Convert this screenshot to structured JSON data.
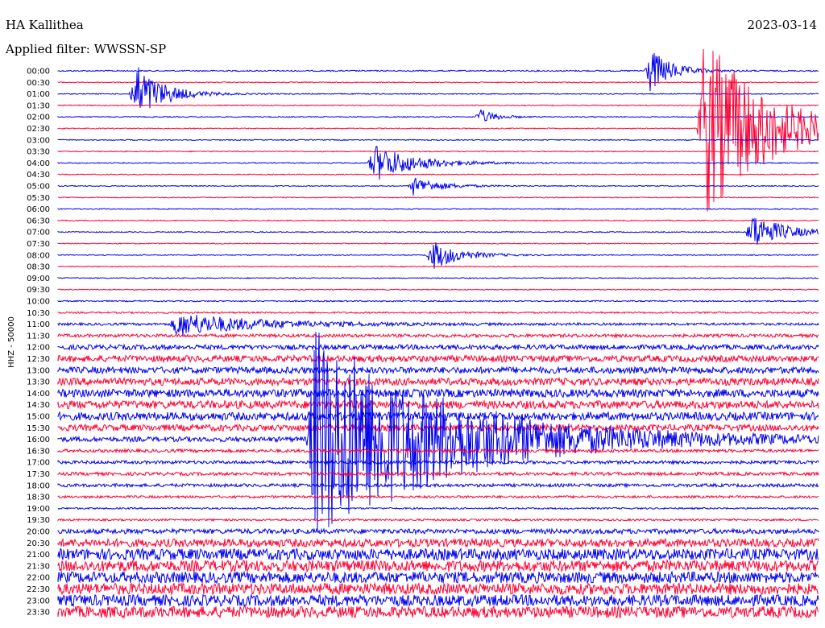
{
  "header": {
    "station": "HA Kallithea",
    "date": "2023-03-14",
    "filter_label": "Applied filter: WWSSN-SP"
  },
  "chart_data": {
    "type": "line",
    "title": "HA Kallithea",
    "ylabel": "HHZ - 50000",
    "trace_labels": [
      "00:00",
      "00:30",
      "01:00",
      "01:30",
      "02:00",
      "02:30",
      "03:00",
      "03:30",
      "04:00",
      "04:30",
      "05:00",
      "05:30",
      "06:00",
      "06:30",
      "07:00",
      "07:30",
      "08:00",
      "08:30",
      "09:00",
      "09:30",
      "10:00",
      "10:30",
      "11:00",
      "11:30",
      "12:00",
      "12:30",
      "13:00",
      "13:30",
      "14:00",
      "14:30",
      "15:00",
      "15:30",
      "16:00",
      "16:30",
      "17:00",
      "17:30",
      "18:00",
      "18:30",
      "19:00",
      "19:30",
      "20:00",
      "20:30",
      "21:00",
      "21:30",
      "22:00",
      "22:30",
      "23:00",
      "23:30"
    ],
    "trace_minutes": 30,
    "colors": [
      "#0000ee",
      "#ff0033"
    ],
    "baseline_noise": [
      0.8,
      0.6,
      0.6,
      0.6,
      0.6,
      0.6,
      0.6,
      0.6,
      0.6,
      0.6,
      0.6,
      0.6,
      0.6,
      0.6,
      0.6,
      0.6,
      0.6,
      0.6,
      0.6,
      0.6,
      0.8,
      1.0,
      1.5,
      2.0,
      3.0,
      4.0,
      4.0,
      4.5,
      5.0,
      5.0,
      5.0,
      4.0,
      3.0,
      2.0,
      2.0,
      2.0,
      2.0,
      1.5,
      1.0,
      1.2,
      3.0,
      5.0,
      7.0,
      7.0,
      7.0,
      7.0,
      7.0,
      7.0
    ],
    "events": [
      {
        "trace": 5,
        "minute": 25.4,
        "amplitude": 120,
        "duration": 2.5
      },
      {
        "trace": 8,
        "minute": 12.4,
        "amplitude": 25,
        "duration": 1.5
      },
      {
        "trace": 2,
        "minute": 3.0,
        "amplitude": 40,
        "duration": 1.0
      },
      {
        "trace": 0,
        "minute": 23.3,
        "amplitude": 30,
        "duration": 0.8
      },
      {
        "trace": 14,
        "minute": 27.3,
        "amplitude": 25,
        "duration": 1.2
      },
      {
        "trace": 16,
        "minute": 14.7,
        "amplitude": 20,
        "duration": 1.0
      },
      {
        "trace": 22,
        "minute": 4.6,
        "amplitude": 15,
        "duration": 3.0
      },
      {
        "trace": 32,
        "minute": 10.0,
        "amplitude": 140,
        "duration": 5.0
      },
      {
        "trace": 10,
        "minute": 14.0,
        "amplitude": 12,
        "duration": 1.0
      },
      {
        "trace": 4,
        "minute": 16.6,
        "amplitude": 10,
        "duration": 0.6
      }
    ]
  }
}
